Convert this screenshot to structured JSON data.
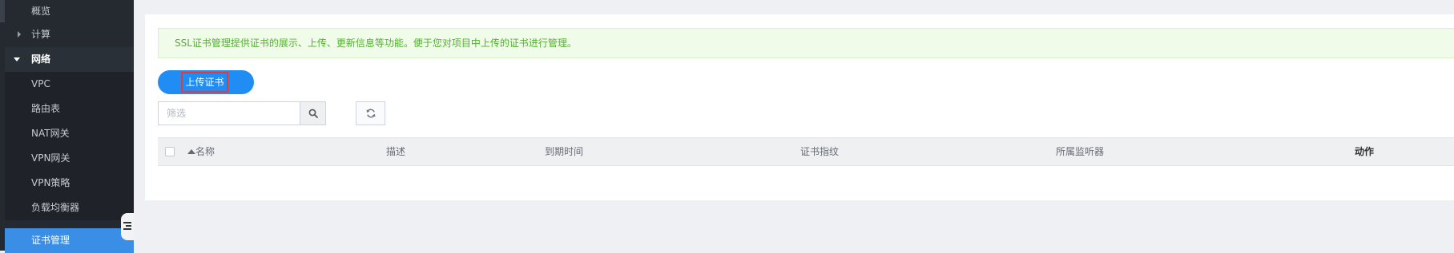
{
  "sidebar": {
    "items": [
      {
        "label": "概览"
      },
      {
        "label": "计算"
      },
      {
        "label": "网络"
      },
      {
        "label": "VPC"
      },
      {
        "label": "路由表"
      },
      {
        "label": "NAT网关"
      },
      {
        "label": "VPN网关"
      },
      {
        "label": "VPN策略"
      },
      {
        "label": "负载均衡器"
      },
      {
        "label": "证书管理"
      }
    ],
    "collapse_icon": "collapse-sidebar-icon"
  },
  "notice": {
    "text": "SSL证书管理提供证书的展示、上传、更新信息等功能。便于您对项目中上传的证书进行管理。"
  },
  "toolbar": {
    "upload_label": "上传证书",
    "filter_placeholder": "筛选",
    "search_icon": "search-icon",
    "refresh_icon": "refresh-icon"
  },
  "table": {
    "columns": [
      "名称",
      "描述",
      "到期时间",
      "证书指纹",
      "所属监听器",
      "动作"
    ]
  },
  "colors": {
    "sidebar_bg": "#252a31",
    "active_item": "#3a8ee6",
    "primary_button": "#1f8df3",
    "notice_text": "#52b230",
    "highlight_border": "#e53a3a"
  }
}
